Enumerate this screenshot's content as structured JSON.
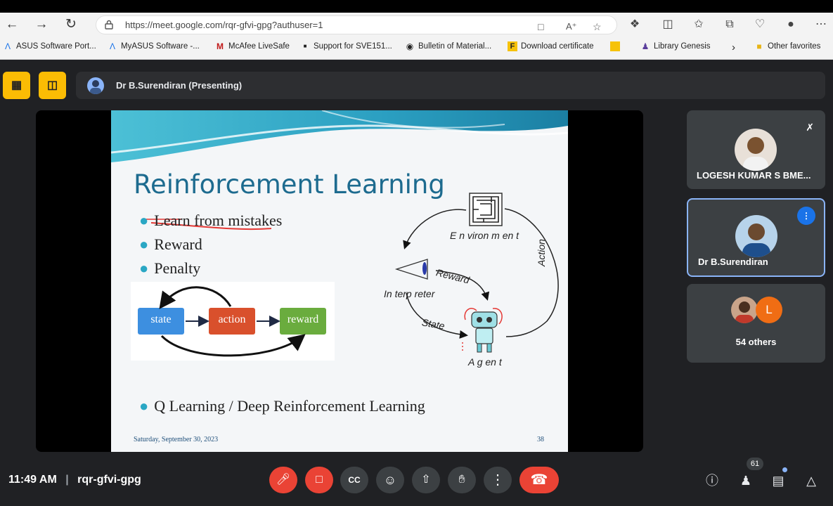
{
  "browser": {
    "url": "https://meet.google.com/rqr-gfvi-gpg?authuser=1",
    "bookmarks": [
      {
        "label": "ASUS Software Port...",
        "icon": "asus-icon"
      },
      {
        "label": "MyASUS Software -...",
        "icon": "asus-icon"
      },
      {
        "label": "McAfee LiveSafe",
        "icon": "mcafee-icon"
      },
      {
        "label": "Support for SVE151...",
        "icon": "dot-icon"
      },
      {
        "label": "Bulletin of Material...",
        "icon": "globe-icon"
      },
      {
        "label": "Download certificate",
        "icon": "f-icon"
      },
      {
        "label": "",
        "icon": "yellow-icon"
      },
      {
        "label": "Library Genesis",
        "icon": "person-icon"
      },
      {
        "label": "Other favorites",
        "icon": "folder-icon"
      }
    ]
  },
  "meet": {
    "presenter_label": "Dr B.Surendiran (Presenting)",
    "time": "11:49 AM",
    "meeting_code": "rqr-gfvi-gpg",
    "participants_count": "61",
    "participants": [
      {
        "name": "LOGESH KUMAR S BME..."
      },
      {
        "name": "Dr B.Surendiran"
      },
      {
        "name": "54 others",
        "avatar_letter": "L"
      }
    ],
    "accent_red": "#ea4335",
    "accent_yellow": "#fbbc04"
  },
  "slide": {
    "title": "Reinforcement Learning",
    "bullets": [
      "Learn from mistakes",
      "Reward",
      "Penalty"
    ],
    "bottom_bullet": "Q Learning / Deep Reinforcement Learning",
    "date": "Saturday, September 30, 2023",
    "page": "38",
    "flow": {
      "state": "state",
      "action": "action",
      "reward": "reward"
    },
    "diagram": {
      "environment": "E n viron m en t",
      "interpreter": "In terp reter",
      "reward": "Reward",
      "state": "State",
      "action": "Action",
      "agent": "A g en t"
    }
  }
}
